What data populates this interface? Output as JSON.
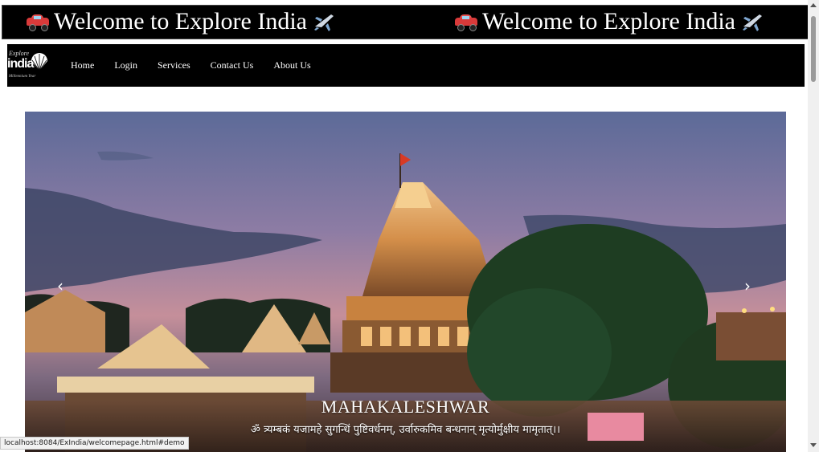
{
  "banner": {
    "text": "Welcome to Explore India",
    "icons": [
      "car-icon",
      "airplane-icon"
    ]
  },
  "logo": {
    "line1": "Explore",
    "line2": "india",
    "line3": "Millennium Year"
  },
  "nav": {
    "items": [
      {
        "label": "Home"
      },
      {
        "label": "Login"
      },
      {
        "label": "Services"
      },
      {
        "label": "Contact Us"
      },
      {
        "label": "About Us"
      }
    ]
  },
  "carousel": {
    "prev_symbol": "‹",
    "next_symbol": "›",
    "caption_title": "MAHAKALESHWAR",
    "caption_text": "ॐ त्र्यम्बकं यजामहे सुगन्धिं पुष्टिवर्धनम्‌, उर्वारुकमिव बन्धनान्‌ मृत्योर्मुक्षीय मामृतात्‌।।"
  },
  "status": {
    "url": "localhost:8084/ExIndia/welcomepage.html#demo"
  }
}
